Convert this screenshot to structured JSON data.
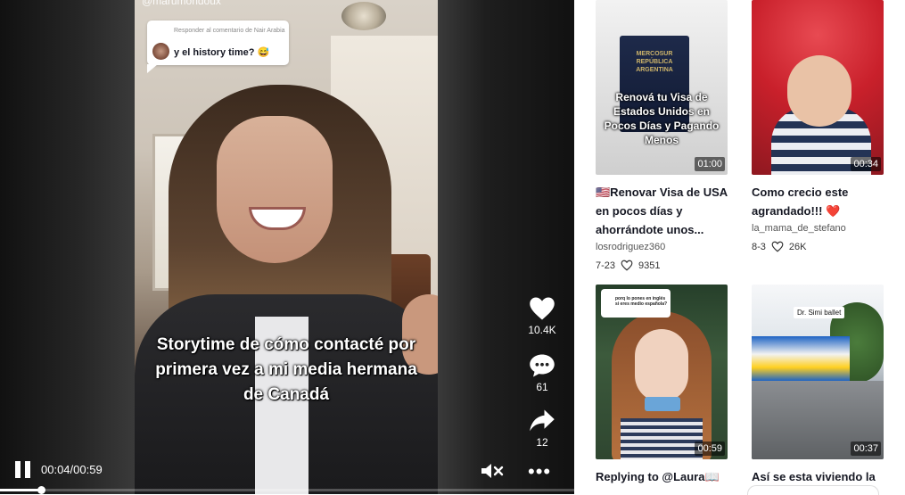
{
  "player": {
    "handle": "@marumondoux",
    "reply": {
      "meta": "Responder al comentario de Nair Arabia",
      "text": "y el history time? 😅"
    },
    "caption": "Storytime de cómo contacté por primera vez a mi media hermana de Canadá",
    "actions": {
      "likes": "10.4K",
      "comments": "61",
      "shares": "12"
    },
    "time": "00:04/00:59",
    "progress_fraction": 0.068,
    "more_label": "•••"
  },
  "related": [
    {
      "title": "🇺🇸Renovar Visa de USA en pocos días y ahorrándote unos...",
      "author": "losrodriguez360",
      "date": "7-23",
      "likes": "9351",
      "duration": "01:00",
      "thumb_caption": "Renová tu Visa de Estados Unidos en Pocos Días y Pagando Menos",
      "thumb_passport": "MERCOSUR REPÚBLICA ARGENTINA"
    },
    {
      "title": "Como crecio este agrandado!!! ❤️",
      "author": "la_mama_de_stefano",
      "date": "8-3",
      "likes": "26K",
      "duration": "00:34"
    },
    {
      "title": "Replying to @Laura📖",
      "duration": "00:59",
      "thumb_bubble": "porq lo pones en inglés si eres medio española?"
    },
    {
      "title": "Así se esta viviendo la",
      "duration": "00:37",
      "thumb_label": "Dr. Simi ballet"
    }
  ]
}
